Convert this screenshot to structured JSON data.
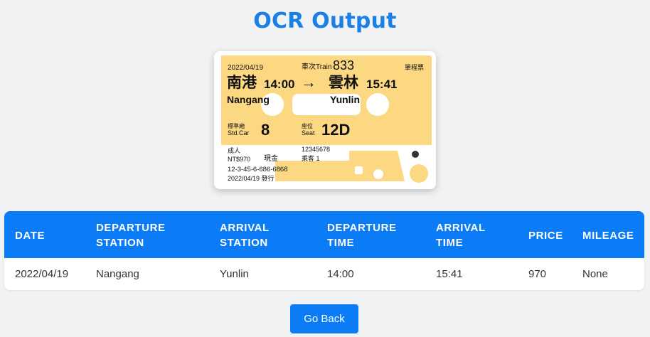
{
  "page": {
    "title": "OCR Output"
  },
  "ticket": {
    "date": "2022/04/19",
    "train_label": "車次Train",
    "train_no": "833",
    "ticket_type": "單程票",
    "from_zh": "南港",
    "depart_time": "14:00",
    "arrow": "→",
    "to_zh": "雲林",
    "arrive_time": "15:41",
    "from_en": "Nangang",
    "to_en": "Yunlin",
    "car_label_zh": "標準廂",
    "car_label_en": "Std.Car",
    "car_no": "8",
    "seat_label_zh": "座位",
    "seat_label_en": "Seat",
    "seat_no": "12D",
    "fare_type": "成人",
    "price": "NT$970",
    "payment": "現金",
    "ticket_code": "12345678",
    "passenger": "乘客 1",
    "serial": "12-3-45-6-686-6868",
    "issued": "2022/04/19 發行"
  },
  "table": {
    "headers": [
      {
        "line1": "DATE",
        "line2": ""
      },
      {
        "line1": "DEPARTURE",
        "line2": "STATION"
      },
      {
        "line1": "ARRIVAL",
        "line2": "STATION"
      },
      {
        "line1": "DEPARTURE",
        "line2": "TIME"
      },
      {
        "line1": "ARRIVAL",
        "line2": "TIME"
      },
      {
        "line1": "PRICE",
        "line2": ""
      },
      {
        "line1": "MILEAGE",
        "line2": ""
      }
    ],
    "row": [
      "2022/04/19",
      "Nangang",
      "Yunlin",
      "14:00",
      "15:41",
      "970",
      "None"
    ]
  },
  "actions": {
    "back_label": "Go Back"
  },
  "colors": {
    "accent": "#0b7cf5",
    "ticket_yellow": "#fdd882"
  }
}
